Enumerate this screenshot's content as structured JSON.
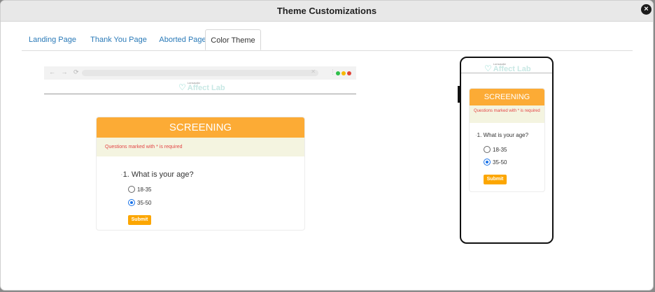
{
  "modal": {
    "title": "Theme Customizations",
    "close_icon": "×"
  },
  "tabs": [
    {
      "label": "Landing Page"
    },
    {
      "label": "Thank You Page"
    },
    {
      "label": "Aborted Page"
    },
    {
      "label": "Color Theme"
    }
  ],
  "browser": {
    "nav": "← → ⟳",
    "menu": "⋮",
    "dots": [
      "#2fbf4a",
      "#f5b800",
      "#e0453a"
    ]
  },
  "logo": {
    "small": "Lonsaudiz",
    "main": "Affect Lab"
  },
  "survey": {
    "title": "SCREENING",
    "note": "Questions marked with * is required",
    "question": "1. What is your age?",
    "options": [
      "18-35",
      "35-50"
    ],
    "selected": "35-50",
    "submit": "Submit"
  },
  "colors": {
    "header": "#fcab35",
    "note_bg": "#f4f4e0",
    "note_text": "#e34545",
    "submit": "#fca600",
    "tab_link": "#2a7ab8"
  }
}
